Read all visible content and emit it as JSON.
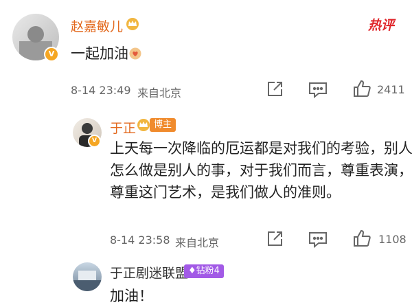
{
  "hot_tab": {
    "label": "热评"
  },
  "comments": [
    {
      "user": "赵嘉敏儿",
      "text": "一起加油",
      "timestamp": "8-14 23:49",
      "location": "来自北京",
      "likes": "2411"
    },
    {
      "user": "于正",
      "badge": "博主",
      "text_lines": [
        "上天每一次降临的厄运都是对我们的考验，别人",
        "怎么做是别人的事，对于我们而言，尊重表演，",
        "尊重这门艺术，是我们做人的准则。"
      ],
      "timestamp": "8-14 23:58",
      "location": "来自北京",
      "likes": "1108"
    },
    {
      "user": "于正剧迷联盟",
      "badge": "钻粉4",
      "text": "加油！"
    }
  ],
  "colors": {
    "name": "#e36a1f",
    "hot": "#e0262b",
    "badge_blogger": "#f08b2d",
    "badge_fan": "#a25ae6"
  },
  "icons": [
    "share-icon",
    "comment-icon",
    "like-icon",
    "heart-emoji-icon",
    "crown-icon",
    "verified-badge-icon"
  ]
}
